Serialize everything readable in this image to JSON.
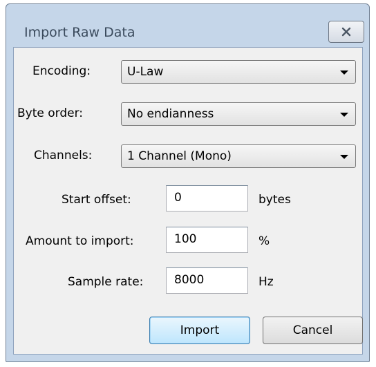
{
  "window": {
    "title": "Import Raw Data",
    "close_icon": "close-icon"
  },
  "fields": {
    "encoding": {
      "label": "Encoding:",
      "value": "U-Law"
    },
    "byte_order": {
      "label": "Byte order:",
      "value": "No endianness"
    },
    "channels": {
      "label": "Channels:",
      "value": "1 Channel (Mono)"
    },
    "start_offset": {
      "label": "Start offset:",
      "value": "0",
      "unit": "bytes"
    },
    "amount": {
      "label": "Amount to import:",
      "value": "100",
      "unit": "%"
    },
    "sample_rate": {
      "label": "Sample rate:",
      "value": "8000",
      "unit": "Hz"
    }
  },
  "buttons": {
    "import": "Import",
    "cancel": "Cancel"
  }
}
